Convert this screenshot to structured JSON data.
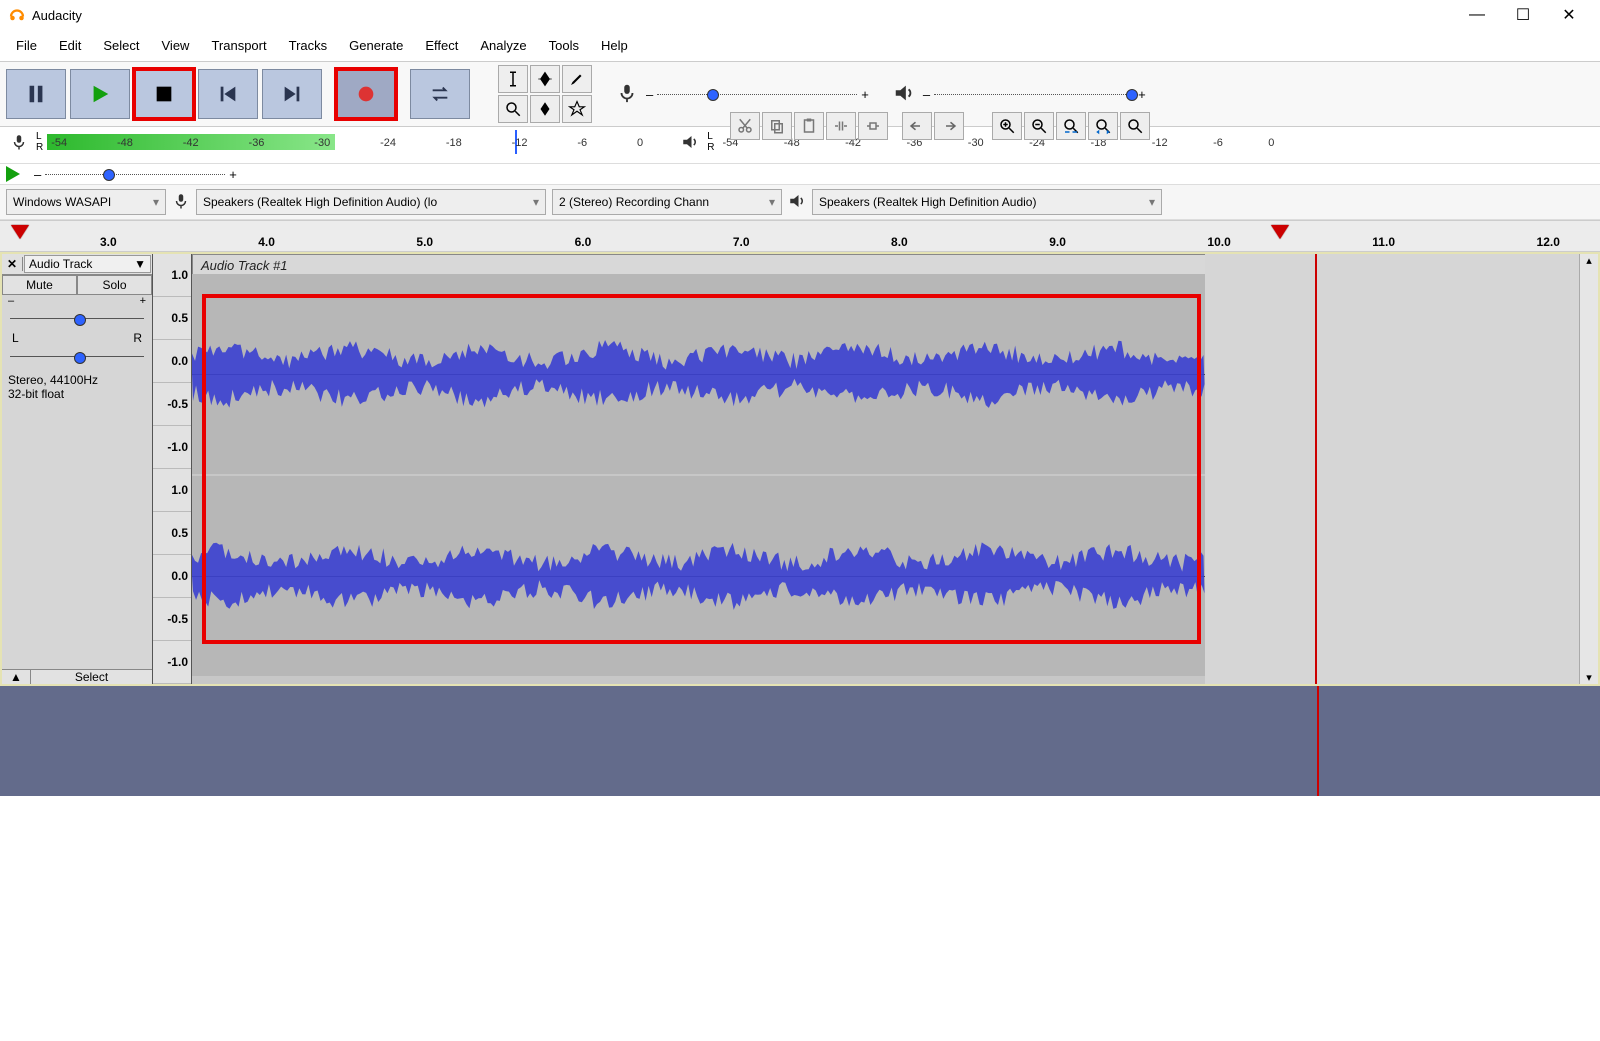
{
  "app_title": "Audacity",
  "window_controls": {
    "minimize": "—",
    "maximize": "☐",
    "close": "✕"
  },
  "menu": [
    "File",
    "Edit",
    "Select",
    "View",
    "Transport",
    "Tracks",
    "Generate",
    "Effect",
    "Analyze",
    "Tools",
    "Help"
  ],
  "transport": {
    "pause": "pause",
    "play": "play",
    "stop": "stop",
    "skip_start": "skip-start",
    "skip_end": "skip-end",
    "record": "record",
    "loop": "loop"
  },
  "rec_meter": {
    "channels": "L\nR",
    "ticks": [
      "-54",
      "-48",
      "-42",
      "-36",
      "-30",
      "-24",
      "-18",
      "-12",
      "-6",
      "0"
    ],
    "level_pct": 48,
    "cursor_pct": 78
  },
  "play_meter": {
    "channels": "L\nR",
    "ticks": [
      "-54",
      "-48",
      "-42",
      "-36",
      "-30",
      "-24",
      "-18",
      "-12",
      "-6",
      "0"
    ]
  },
  "devices": {
    "host": "Windows WASAPI",
    "rec_device": "Speakers (Realtek High Definition Audio) (lo",
    "rec_channels": "2 (Stereo) Recording Chann",
    "play_device": "Speakers (Realtek High Definition Audio)"
  },
  "timeline": {
    "ticks": [
      "3.0",
      "4.0",
      "5.0",
      "6.0",
      "7.0",
      "8.0",
      "9.0",
      "10.0",
      "11.0",
      "12.0"
    ],
    "start_tri_pct": 1,
    "play_tri_pct": 80
  },
  "track": {
    "close": "✕",
    "dropdown_label": "Audio Track",
    "mute": "Mute",
    "solo": "Solo",
    "gain_minus": "–",
    "gain_plus": "+",
    "pan_L": "L",
    "pan_R": "R",
    "info_line1": "Stereo, 44100Hz",
    "info_line2": "32-bit float",
    "collapse": "▲",
    "select": "Select",
    "banner": "Audio Track #1",
    "amp_ticks": [
      "1.0",
      "0.5",
      "0.0",
      "-0.5",
      "-1.0",
      "1.0",
      "0.5",
      "0.0",
      "-0.5",
      "-1.0"
    ]
  },
  "playback_slider": {
    "minus": "–",
    "plus": "+"
  },
  "rec_slider": {
    "pos_pct": 25
  },
  "play_slider": {
    "pos_pct": 98
  }
}
